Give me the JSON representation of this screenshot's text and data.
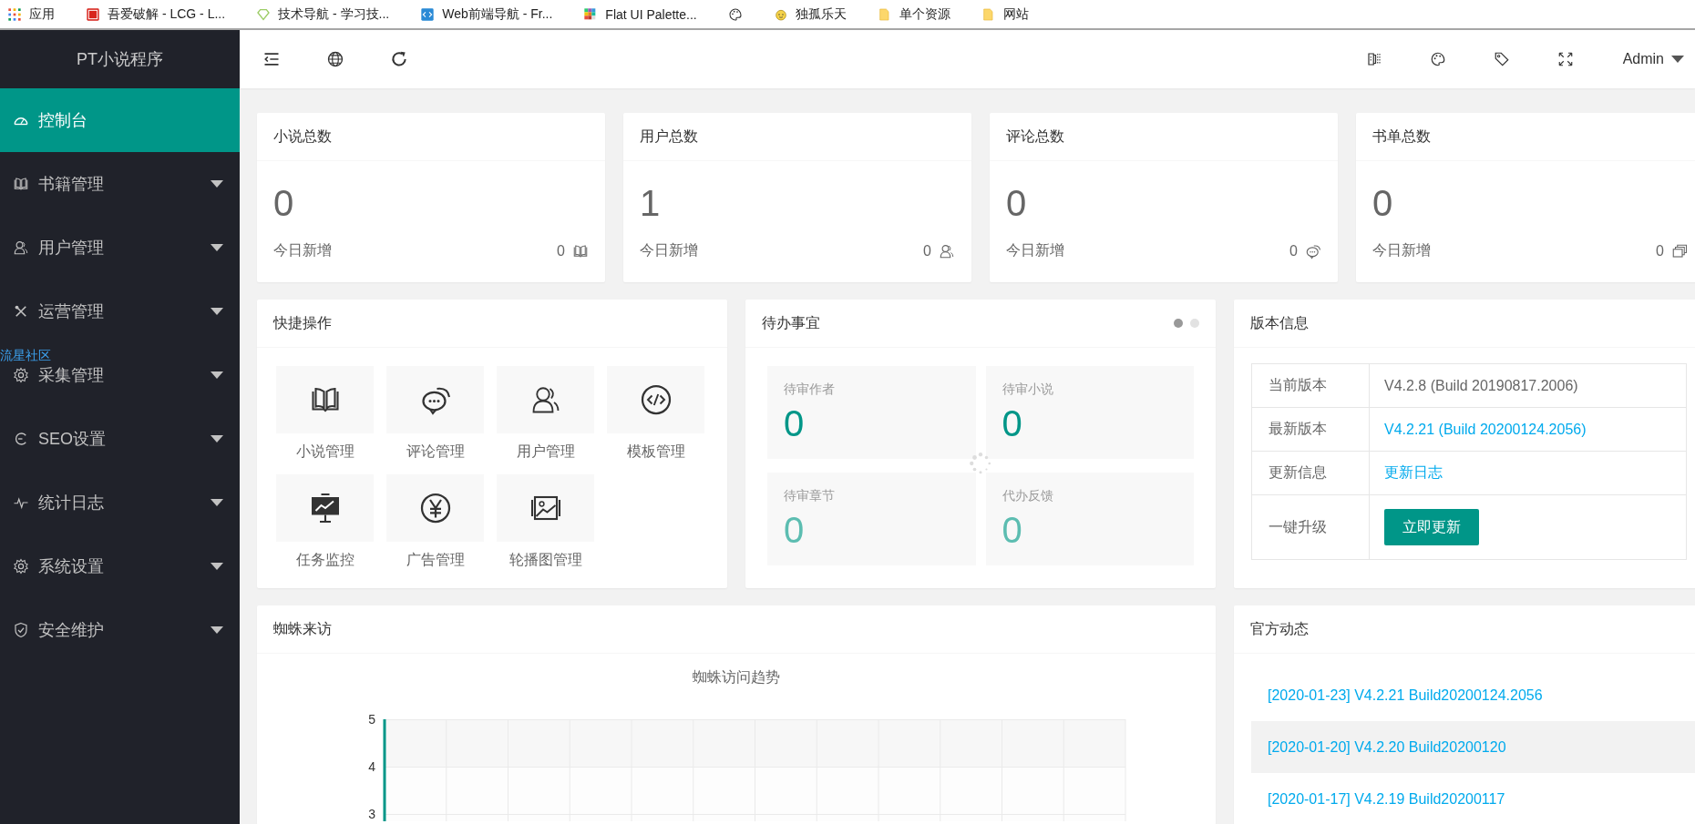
{
  "bookmarks": [
    {
      "label": "应用",
      "kind": "apps"
    },
    {
      "label": "吾爱破解 - LCG - L...",
      "kind": "badge"
    },
    {
      "label": "技术导航 - 学习技...",
      "kind": "diamond"
    },
    {
      "label": "Web前端导航 - Fr...",
      "kind": "code"
    },
    {
      "label": "Flat UI Palette...",
      "kind": "mosaic"
    },
    {
      "kind": "palette"
    },
    {
      "label": "独孤乐天",
      "kind": "face"
    },
    {
      "label": "单个资源",
      "kind": "folder"
    },
    {
      "label": "网站",
      "kind": "folder"
    }
  ],
  "sidebar": {
    "title": "PT小说程序",
    "items": [
      {
        "label": "控制台",
        "kind": "gauge",
        "selected": true,
        "has_submenu": false
      },
      {
        "label": "书籍管理",
        "kind": "book",
        "selected": false,
        "has_submenu": true
      },
      {
        "label": "用户管理",
        "kind": "user",
        "selected": false,
        "has_submenu": true
      },
      {
        "label": "运营管理",
        "kind": "tools",
        "selected": false,
        "has_submenu": true
      },
      {
        "label": "采集管理",
        "kind": "gear",
        "selected": false,
        "has_submenu": true
      },
      {
        "label": "SEO设置",
        "kind": "cycle",
        "selected": false,
        "has_submenu": true
      },
      {
        "label": "统计日志",
        "kind": "pulse",
        "selected": false,
        "has_submenu": true
      },
      {
        "label": "系统设置",
        "kind": "gear",
        "selected": false,
        "has_submenu": true
      },
      {
        "label": "安全维护",
        "kind": "shield",
        "selected": false,
        "has_submenu": true
      }
    ],
    "overlay_link": "流星社区"
  },
  "header": {
    "left_tools": [
      {
        "kind": "indent"
      },
      {
        "kind": "globe"
      },
      {
        "kind": "refresh"
      }
    ],
    "right_tools": [
      {
        "kind": "notes"
      },
      {
        "kind": "palette"
      },
      {
        "kind": "tag"
      },
      {
        "kind": "fullscreen"
      }
    ],
    "user": "Admin"
  },
  "stats": [
    {
      "title": "小说总数",
      "value": "0",
      "sub_label": "今日新增",
      "today": "0",
      "kind": "book"
    },
    {
      "title": "用户总数",
      "value": "1",
      "sub_label": "今日新增",
      "today": "0",
      "kind": "user"
    },
    {
      "title": "评论总数",
      "value": "0",
      "sub_label": "今日新增",
      "today": "0",
      "kind": "chat"
    },
    {
      "title": "书单总数",
      "value": "0",
      "sub_label": "今日新增",
      "today": "0",
      "kind": "cards"
    }
  ],
  "quick_actions": {
    "title": "快捷操作",
    "items": [
      {
        "label": "小说管理",
        "kind": "book"
      },
      {
        "label": "评论管理",
        "kind": "chat"
      },
      {
        "label": "用户管理",
        "kind": "users"
      },
      {
        "label": "模板管理",
        "kind": "code_circle"
      },
      {
        "label": "任务监控",
        "kind": "board"
      },
      {
        "label": "广告管理",
        "kind": "yen"
      },
      {
        "label": "轮播图管理",
        "kind": "image"
      }
    ]
  },
  "todo": {
    "title": "待办事宜",
    "pages": [
      {
        "selected": true
      },
      {
        "selected": false
      }
    ],
    "items": [
      {
        "label": "待审作者",
        "value": "0",
        "dim": false
      },
      {
        "label": "待审小说",
        "value": "0",
        "dim": false
      },
      {
        "label": "待审章节",
        "value": "0",
        "dim": true
      },
      {
        "label": "代办反馈",
        "value": "0",
        "dim": true
      }
    ]
  },
  "version": {
    "title": "版本信息",
    "rows": [
      {
        "label": "当前版本",
        "value": "V4.2.8 (Build 20190817.2006)",
        "kind": "text"
      },
      {
        "label": "最新版本",
        "value": "V4.2.21 (Build 20200124.2056)",
        "kind": "link"
      },
      {
        "label": "更新信息",
        "value": "更新日志",
        "kind": "link"
      },
      {
        "label": "一键升级",
        "value": "立即更新",
        "kind": "button"
      }
    ]
  },
  "spider": {
    "title": "蜘蛛来访",
    "chart_title": "蜘蛛访问趋势",
    "y_tick_labels": [
      "5",
      "4",
      "3"
    ]
  },
  "news": {
    "title": "官方动态",
    "items": [
      {
        "label": "[2020-01-23] V4.2.21 Build20200124.2056"
      },
      {
        "label": "[2020-01-20] V4.2.20 Build20200120"
      },
      {
        "label": "[2020-01-17] V4.2.19 Build20200117"
      }
    ]
  }
}
